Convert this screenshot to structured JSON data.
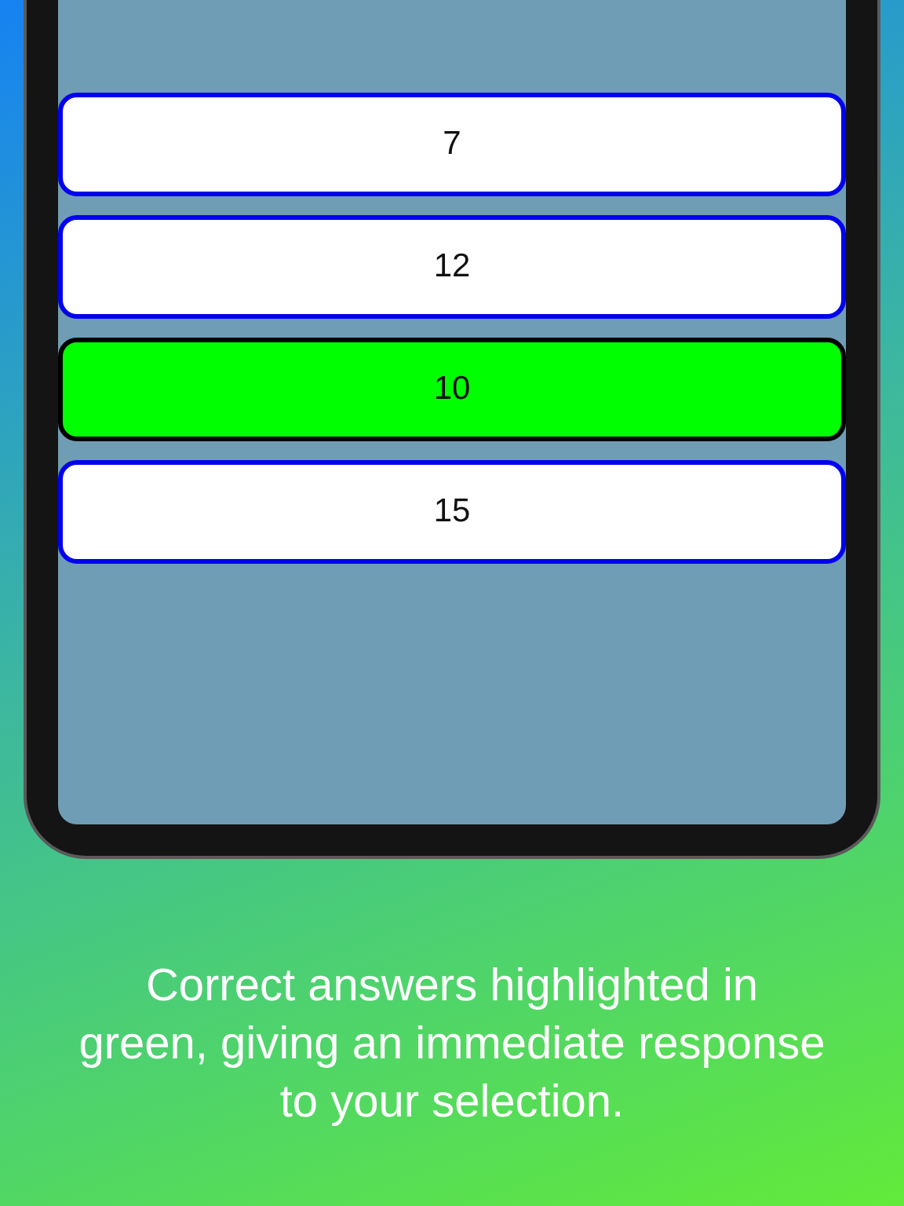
{
  "answers": [
    {
      "label": "7",
      "correct": false
    },
    {
      "label": "12",
      "correct": false
    },
    {
      "label": "10",
      "correct": true
    },
    {
      "label": "15",
      "correct": false
    }
  ],
  "caption": "Correct answers highlighted in green, giving an immediate response to your selection."
}
